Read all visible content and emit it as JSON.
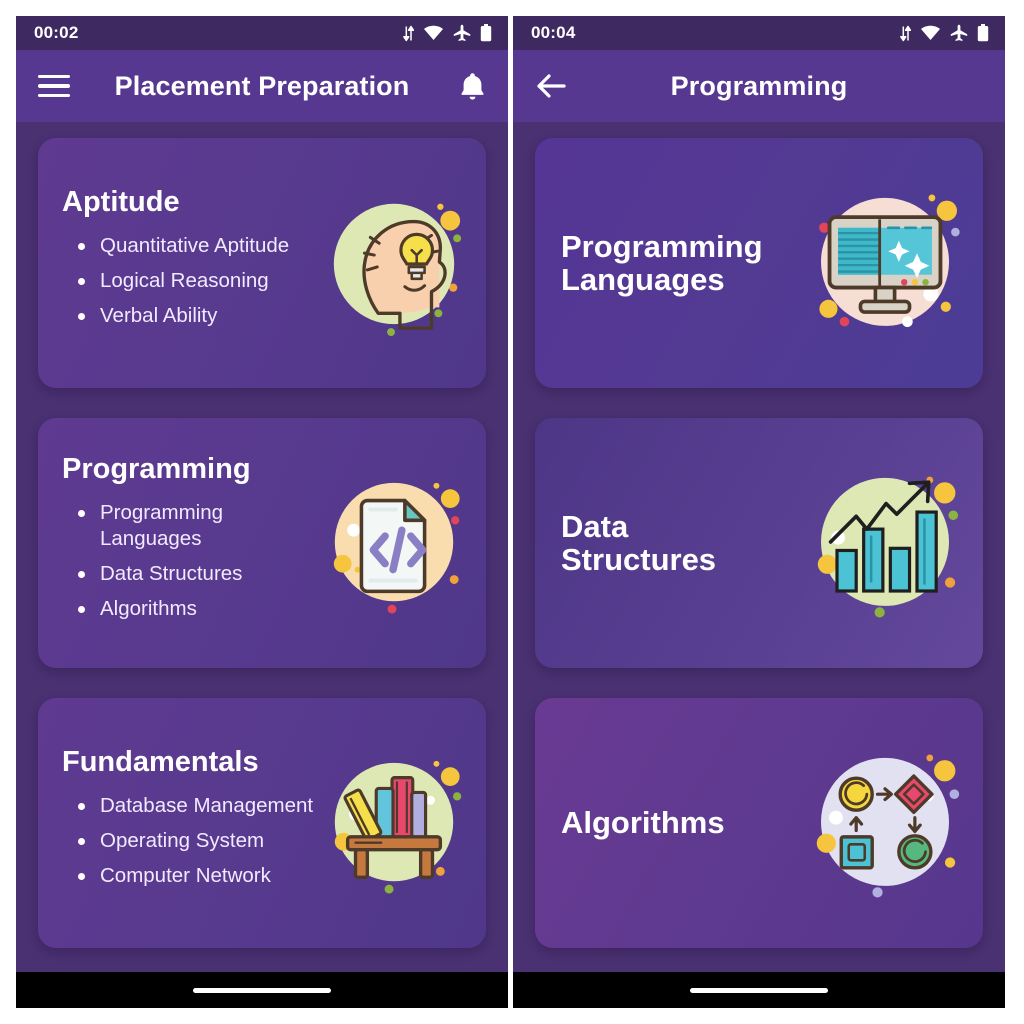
{
  "phones": [
    {
      "id": "placement-preparation",
      "status": {
        "time": "00:02",
        "icons": [
          "data-transfer-icon",
          "wifi-icon",
          "airplane-mode-icon",
          "battery-icon"
        ]
      },
      "appbar": {
        "title": "Placement Preparation",
        "lead_icon": "hamburger-menu-icon",
        "trail_icon": "notification-bell-icon"
      },
      "cards": [
        {
          "title": "Aptitude",
          "icon": "head-lightbulb-icon",
          "items": [
            "Quantitative Aptitude",
            "Logical Reasoning",
            "Verbal Ability"
          ]
        },
        {
          "title": "Programming",
          "icon": "code-file-icon",
          "items": [
            "Programming Languages",
            "Data Structures",
            "Algorithms"
          ]
        },
        {
          "title": "Fundamentals",
          "icon": "bookshelf-icon",
          "items": [
            "Database Management",
            "Operating System",
            "Computer Network"
          ]
        }
      ]
    },
    {
      "id": "programming",
      "status": {
        "time": "00:04",
        "icons": [
          "data-transfer-icon",
          "wifi-icon",
          "airplane-mode-icon",
          "battery-icon"
        ]
      },
      "appbar": {
        "title": "Programming",
        "lead_icon": "back-arrow-icon",
        "trail_icon": ""
      },
      "cards": [
        {
          "title": "Programming\nLanguages",
          "icon": "monitor-code-icon"
        },
        {
          "title": "Data\nStructures",
          "icon": "bar-chart-growth-icon"
        },
        {
          "title": "Algorithms",
          "icon": "flowchart-icon"
        }
      ]
    }
  ],
  "colors": {
    "screen_background": "#4a3172",
    "status_bar": "#3e2a61",
    "app_bar": "#563891",
    "card_purple": "#573a90",
    "nav_bar": "#000000",
    "text_primary": "#ffffff",
    "text_secondary": "#f2eaff",
    "icon_circle_green": "#dde8b4",
    "icon_circle_cream": "#f9ddae",
    "icon_circle_pink": "#f7ded4",
    "icon_circle_lilac": "#e2e1f2",
    "accent_yellow": "#f5c53d",
    "accent_red": "#e1455a",
    "accent_teal": "#4bc3d4"
  }
}
